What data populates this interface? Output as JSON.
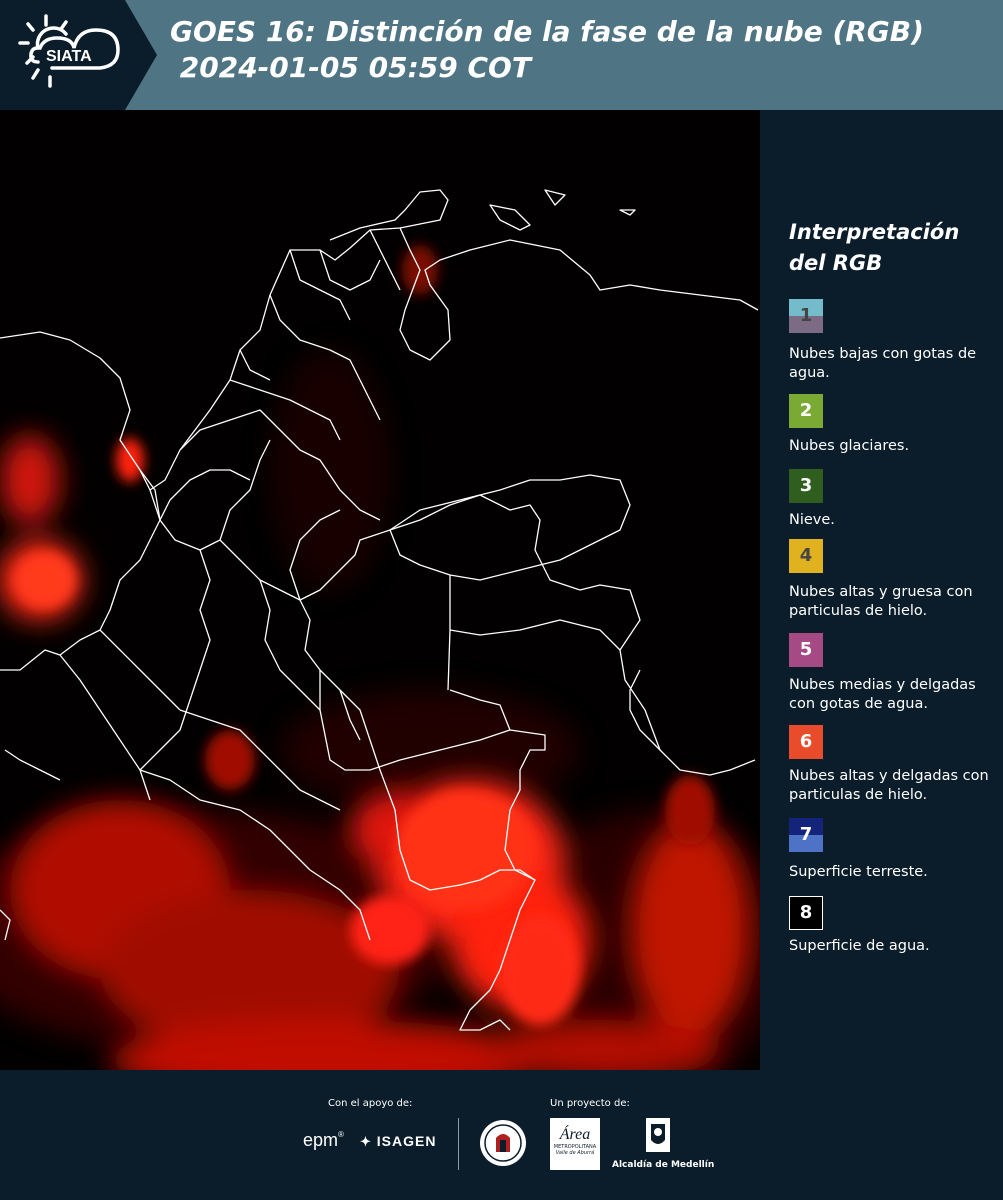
{
  "header": {
    "logo_text": "SIATA",
    "title_line1": "GOES 16: Distinción de la fase de la nube (RGB)",
    "title_line2": " 2024-01-05 05:59 COT"
  },
  "legend": {
    "title": "Interpretación del RGB",
    "items": [
      {
        "num": "1",
        "label": "Nubes bajas con gotas de agua.",
        "color_top": "#74bccc",
        "color_bottom": "#7c6b85"
      },
      {
        "num": "2",
        "label": "Nubes glaciares.",
        "color_top": "#7aa934",
        "color_bottom": "#7aa934"
      },
      {
        "num": "3",
        "label": "Nieve.",
        "color_top": "#2f5e1e",
        "color_bottom": "#2f5e1e"
      },
      {
        "num": "4",
        "label": "Nubes altas y gruesa con particulas de hielo.",
        "color_top": "#e0b21f",
        "color_bottom": "#e0b21f"
      },
      {
        "num": "5",
        "label": "Nubes medias y delgadas con gotas de agua.",
        "color_top": "#a54a85",
        "color_bottom": "#a54a85"
      },
      {
        "num": "6",
        "label": "Nubes altas y delgadas con particulas de hielo.",
        "color_top": "#e84c2a",
        "color_bottom": "#e84c2a"
      },
      {
        "num": "7",
        "label": "Superficie terreste.",
        "color_top": "#14247a",
        "color_bottom": "#4d72c6"
      },
      {
        "num": "8",
        "label": "Superficie de agua.",
        "color_top": "#000000",
        "color_bottom": "#000000"
      }
    ]
  },
  "footer": {
    "support_label": "Con el apoyo de:",
    "project_label": "Un proyecto de:",
    "epm_text": "epm",
    "isagen_text": "ISAGEN",
    "area_text": "Área",
    "area_sub": "METROPOLITANA",
    "area_sub2": "Valle de Aburrá",
    "alcaldia_text": "Alcaldía de Medellín"
  },
  "colors": {
    "header_bg": "#4f7484",
    "panel_bg": "#0b1d2a",
    "cloud_red": "#ff1a0a"
  }
}
